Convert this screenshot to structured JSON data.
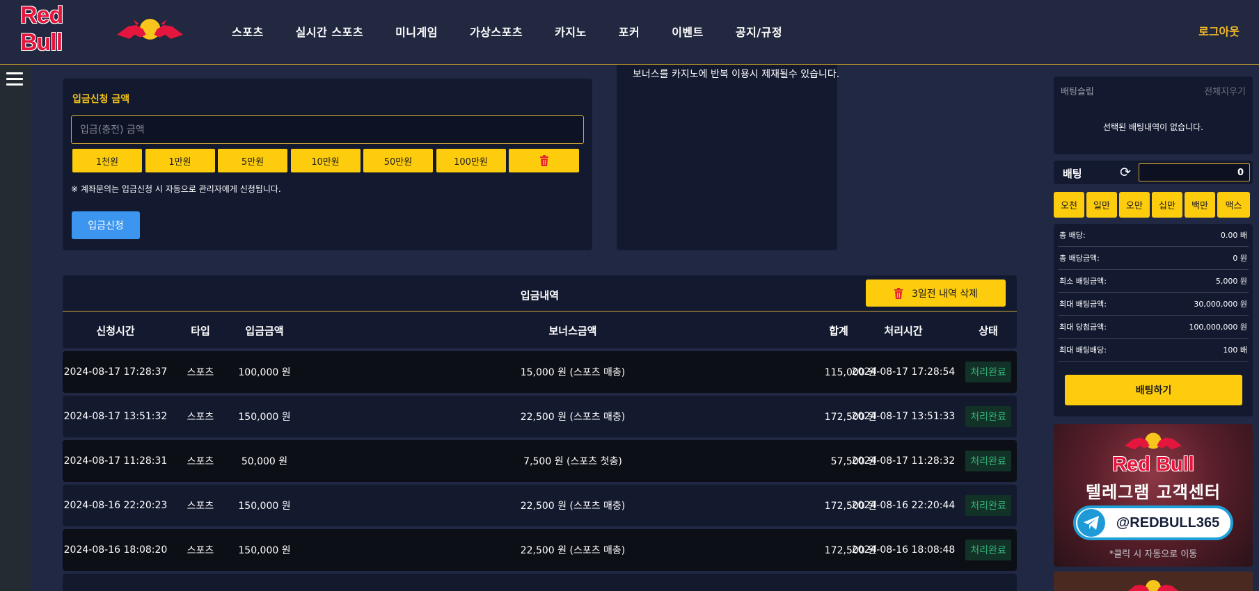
{
  "header": {
    "brand": "Red Bull",
    "nav": [
      "스포츠",
      "실시간 스포츠",
      "미니게임",
      "가상스포츠",
      "카지노",
      "포커",
      "이벤트",
      "공지/규정"
    ],
    "logout": "로그아웃"
  },
  "deposit": {
    "title": "입금신청 금액",
    "placeholder": "입금(충전) 금액",
    "amounts": [
      "1천원",
      "1만원",
      "5만원",
      "10만원",
      "50만원",
      "100만원"
    ],
    "note": "※ 계좌문의는 입금신청 시 자동으로 관리자에게 신청됩니다.",
    "submit": "입금신청"
  },
  "notice": {
    "text": "보너스를 카지노에 반복 이용시 제재될수 있습니다."
  },
  "history": {
    "title": "입금내역",
    "delete_label": "3일전 내역 삭제",
    "columns": [
      "신청시간",
      "타입",
      "입금금액",
      "보너스금액",
      "합계",
      "처리시간",
      "상태"
    ],
    "rows": [
      {
        "time": "2024-08-17 17:28:37",
        "type": "스포츠",
        "amount": "100,000 원",
        "bonus": "15,000 원 (스포츠 매충)",
        "total": "115,000 원",
        "processed": "2024-08-17 17:28:54",
        "status": "처리완료"
      },
      {
        "time": "2024-08-17 13:51:32",
        "type": "스포츠",
        "amount": "150,000 원",
        "bonus": "22,500 원 (스포츠 매충)",
        "total": "172,500 원",
        "processed": "2024-08-17 13:51:33",
        "status": "처리완료"
      },
      {
        "time": "2024-08-17 11:28:31",
        "type": "스포츠",
        "amount": "50,000 원",
        "bonus": "7,500 원 (스포츠 첫충)",
        "total": "57,500 원",
        "processed": "2024-08-17 11:28:32",
        "status": "처리완료"
      },
      {
        "time": "2024-08-16 22:20:23",
        "type": "스포츠",
        "amount": "150,000 원",
        "bonus": "22,500 원 (스포츠 매충)",
        "total": "172,500 원",
        "processed": "2024-08-16 22:20:44",
        "status": "처리완료"
      },
      {
        "time": "2024-08-16 18:08:20",
        "type": "스포츠",
        "amount": "150,000 원",
        "bonus": "22,500 원 (스포츠 매충)",
        "total": "172,500 원",
        "processed": "2024-08-16 18:08:48",
        "status": "처리완료"
      }
    ]
  },
  "betslip": {
    "title": "배팅슬립",
    "clear": "전체지우기",
    "empty": "선택된 배팅내역이 없습니다.",
    "bet_label": "배팅",
    "bet_value": "0",
    "quick": [
      "오천",
      "일만",
      "오만",
      "십만",
      "백만",
      "맥스"
    ],
    "summary": [
      {
        "label": "총 배당:",
        "value": "0.00 배"
      },
      {
        "label": "총 배당금액:",
        "value": "0 원"
      },
      {
        "label": "최소 배팅금액:",
        "value": "5,000 원"
      },
      {
        "label": "최대 배팅금액:",
        "value": "30,000,000 원"
      },
      {
        "label": "최대 당첨금액:",
        "value": "100,000,000 원"
      },
      {
        "label": "최대 배팅배당:",
        "value": "100 배"
      }
    ],
    "submit": "배팅하기"
  },
  "banner": {
    "brand": "Red Bull",
    "title": "텔레그램 고객센터",
    "handle": "@REDBULL365",
    "note": "*클릭 시 자동으로 이동"
  },
  "colors": {
    "accent": "#fdcc0d",
    "brand_red": "#e4163d",
    "status_green": "#33b27a",
    "primary_blue": "#3c96ef"
  }
}
